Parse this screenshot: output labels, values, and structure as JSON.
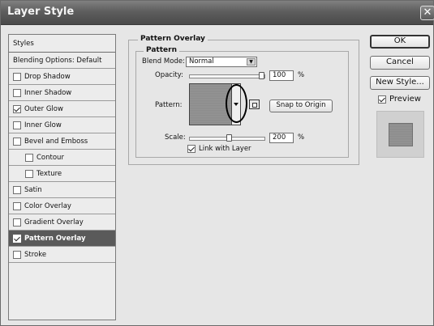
{
  "window": {
    "title": "Layer Style",
    "close_glyph": "✕"
  },
  "styles_list": {
    "header": "Styles",
    "blending": "Blending Options: Default",
    "items": [
      {
        "label": "Drop Shadow",
        "checked": false
      },
      {
        "label": "Inner Shadow",
        "checked": false
      },
      {
        "label": "Outer Glow",
        "checked": true
      },
      {
        "label": "Inner Glow",
        "checked": false
      },
      {
        "label": "Bevel and Emboss",
        "checked": false
      },
      {
        "label": "Contour",
        "checked": false
      },
      {
        "label": "Texture",
        "checked": false
      },
      {
        "label": "Satin",
        "checked": false
      },
      {
        "label": "Color Overlay",
        "checked": false
      },
      {
        "label": "Gradient Overlay",
        "checked": false
      },
      {
        "label": "Pattern Overlay",
        "checked": true,
        "selected": true
      },
      {
        "label": "Stroke",
        "checked": false
      }
    ]
  },
  "pattern_overlay": {
    "group_title": "Pattern Overlay",
    "subgroup_title": "Pattern",
    "blend_mode_label": "Blend Mode:",
    "blend_mode_value": "Normal",
    "opacity_label": "Opacity:",
    "opacity_value": "100",
    "opacity_unit": "%",
    "pattern_label": "Pattern:",
    "snap_button": "Snap to Origin",
    "scale_label": "Scale:",
    "scale_value": "200",
    "scale_unit": "%",
    "link_label": "Link with Layer",
    "link_checked": true
  },
  "actions": {
    "ok": "OK",
    "cancel": "Cancel",
    "new_style": "New Style...",
    "preview_label": "Preview",
    "preview_checked": true
  },
  "icons": {
    "close": "close-icon",
    "dropdown": "chevron-down-icon",
    "new_preset": "new-preset-icon"
  }
}
